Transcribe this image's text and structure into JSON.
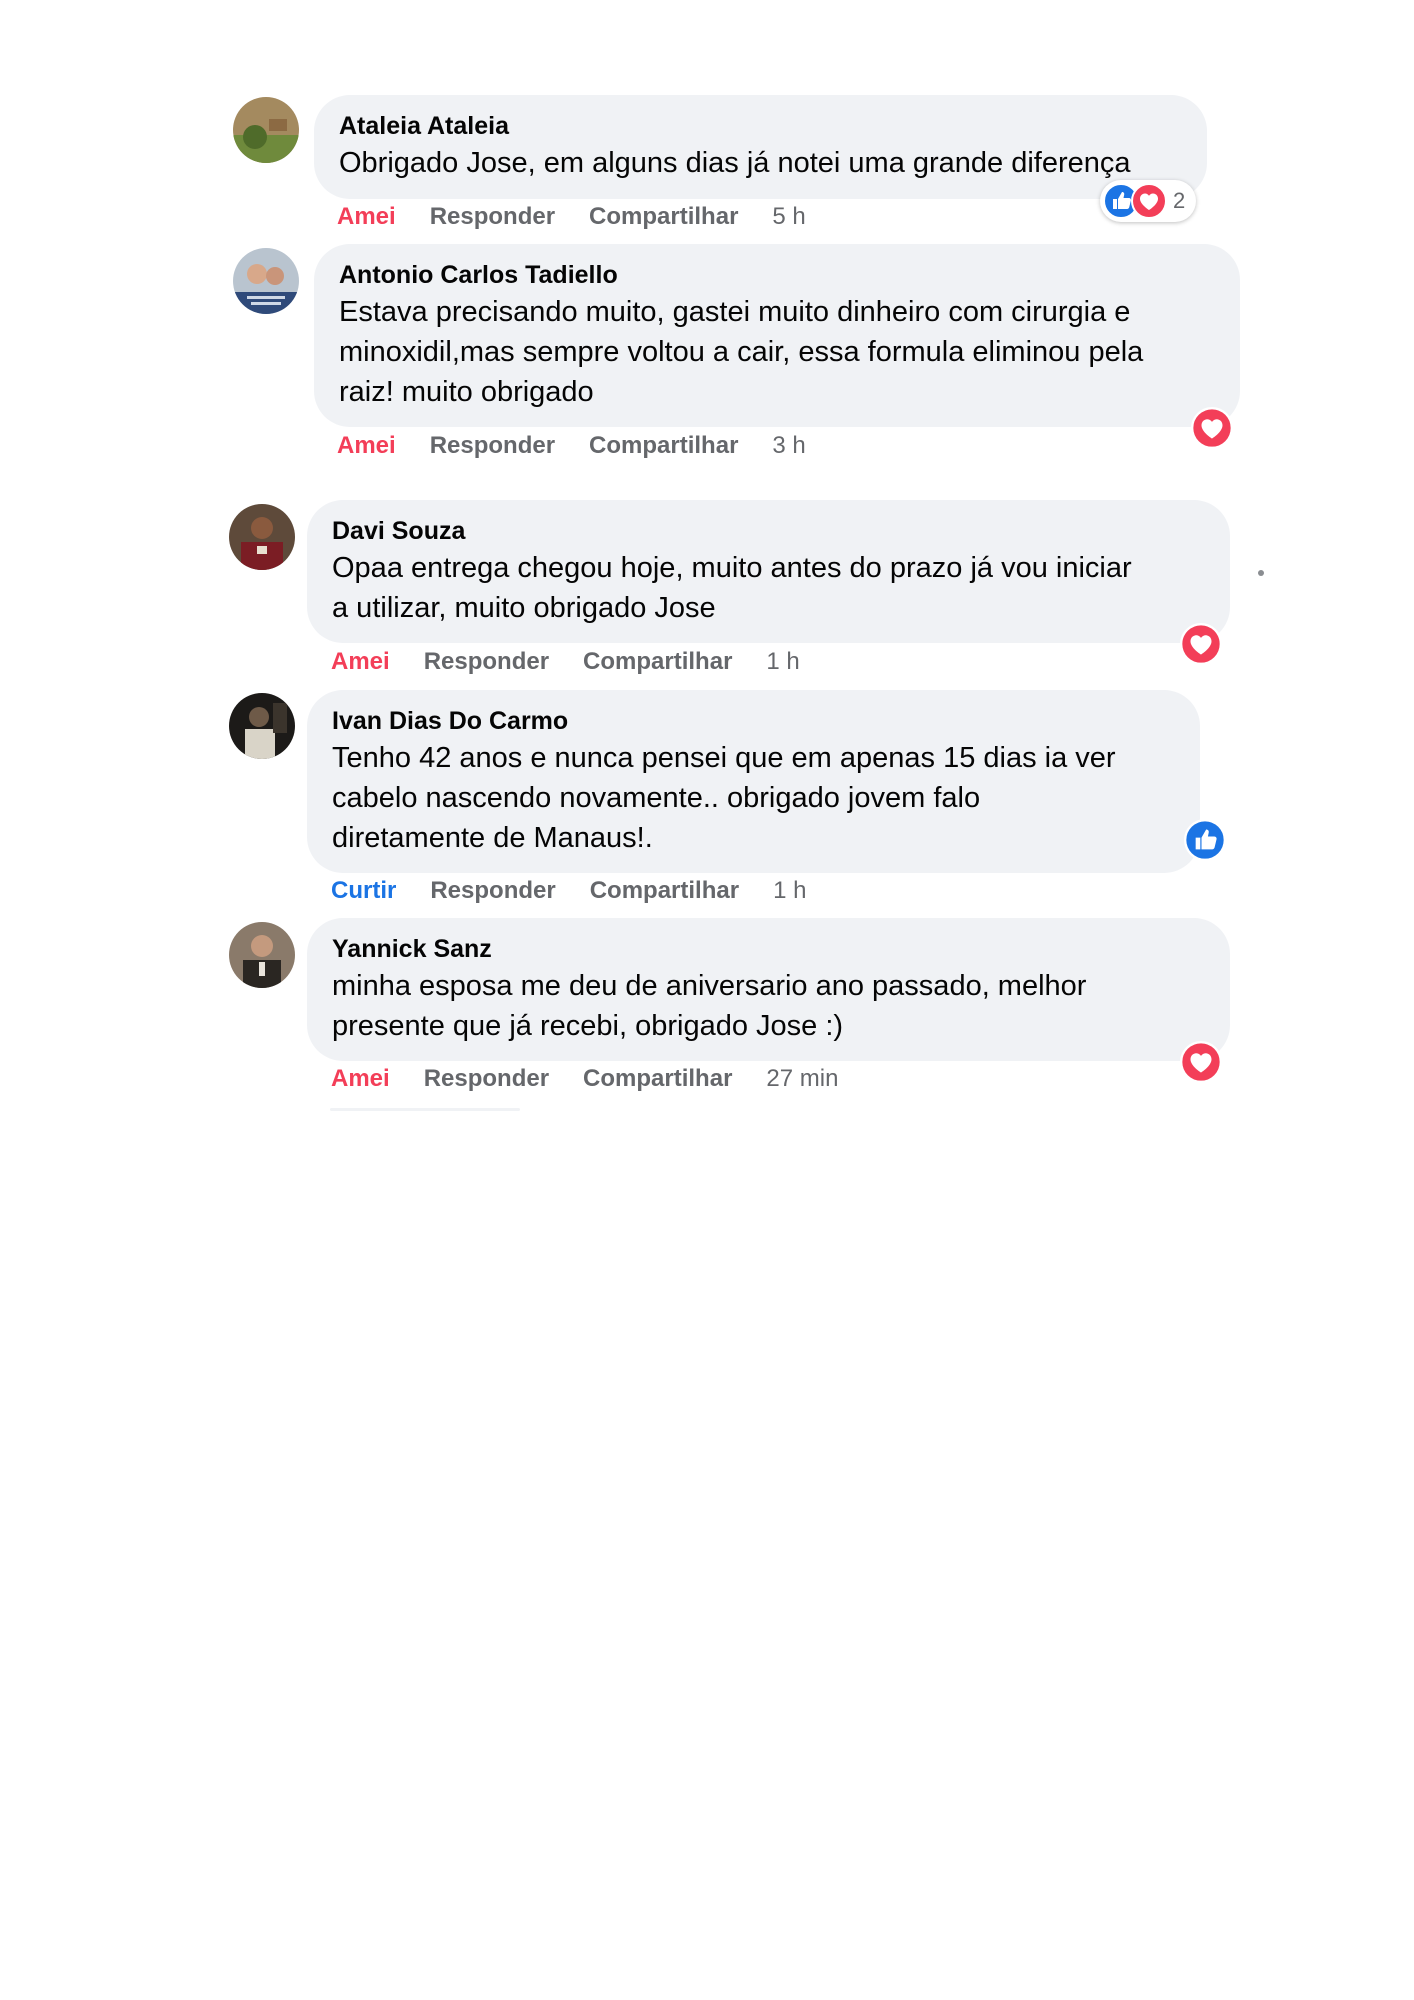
{
  "actions": {
    "reply_label": "Responder",
    "share_label": "Compartilhar"
  },
  "comments": [
    {
      "author": "Ataleia Ataleia",
      "lines": [
        "Obrigado Jose, em alguns dias já notei uma grande diferença"
      ],
      "reaction_label": "Amei",
      "time": "5 h",
      "reactions": [
        "like",
        "love"
      ],
      "reaction_count": "2"
    },
    {
      "author": "Antonio Carlos Tadiello",
      "lines": [
        "Estava precisando muito, gastei muito dinheiro com cirurgia e",
        "minoxidil,mas sempre voltou a cair, essa formula eliminou pela",
        "raiz! muito obrigado"
      ],
      "reaction_label": "Amei",
      "time": "3 h",
      "reactions": [
        "love"
      ]
    },
    {
      "author": "Davi Souza",
      "lines": [
        "Opaa entrega chegou hoje, muito antes do prazo já vou iniciar",
        "a utilizar, muito obrigado Jose"
      ],
      "reaction_label": "Amei",
      "time": "1 h",
      "reactions": [
        "love"
      ]
    },
    {
      "author": "Ivan Dias Do Carmo",
      "lines": [
        "Tenho 42 anos e nunca pensei que em apenas 15 dias ia ver",
        "cabelo nascendo novamente.. obrigado jovem falo",
        "diretamente de Manaus!."
      ],
      "reaction_label": "Curtir",
      "time": "1 h",
      "reactions": [
        "like"
      ]
    },
    {
      "author": "Yannick Sanz",
      "lines": [
        "minha esposa me deu de aniversario ano passado, melhor",
        "presente que já recebi, obrigado Jose :)"
      ],
      "reaction_label": "Amei",
      "time": "27 min",
      "reactions": [
        "love"
      ]
    }
  ],
  "colors": {
    "love": "#f33e58",
    "like": "#1b74e4",
    "bubble": "#f0f2f5",
    "secondary_text": "#65676b"
  }
}
